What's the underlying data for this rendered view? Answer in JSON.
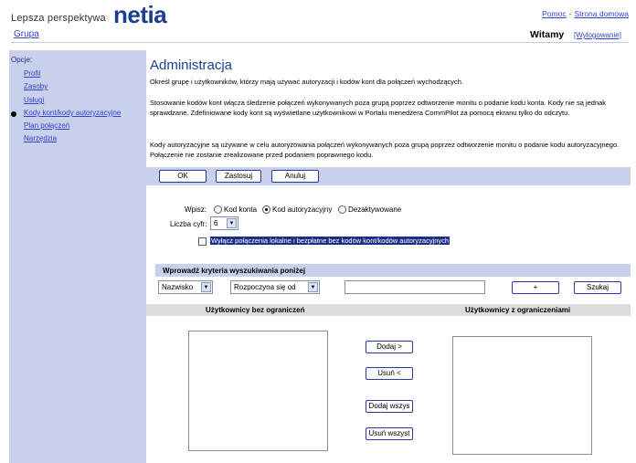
{
  "header": {
    "logo_tagline": "Lepsza perspektywa",
    "logo_word": "netia",
    "help_link": "Pomoc",
    "separator": "-",
    "home_link": "Strona domowa",
    "group_link": "Grupa",
    "welcome": "Witamy",
    "logout_link": "[Wylogowanie]"
  },
  "sidebar": {
    "title": "Opcje:",
    "items": [
      {
        "label": "Profil"
      },
      {
        "label": "Zasoby"
      },
      {
        "label": "Usługi"
      },
      {
        "label": "Kody kont/kody autoryzacyjne",
        "active": true
      },
      {
        "label": "Plan połączeń"
      },
      {
        "label": "Narzędzia"
      }
    ]
  },
  "main": {
    "title": "Administracja",
    "desc1": "Określ grupę i użytkowników, którzy mają używać autoryzacji i kodów kont dla połączeń wychodzących.",
    "desc2": "Stosowanie kodów kont włącza śledzenie połączeń wykonywanych poza grupą poprzez odtworzenie monitu o podanie kodu konta. Kody nie są jednak sprawdzane. Zdefiniowane kody kont są wyświetlane użytkownikowi w Portalu menedżera CommPilot za pomocą ekranu tylko do odczytu.",
    "desc3": "Kody autoryzacyjne są używane w celu autoryzowania połączeń wykonywanych poza grupą poprzez odtworzenie monitu o podanie kodu autoryzacyjnego. Połączenie nie zostanie zrealizowane przed podaniem poprawnego kodu.",
    "buttons": {
      "ok": "OK",
      "apply": "Zastosuj",
      "cancel": "Anuluj"
    },
    "type_label": "Wpisz:",
    "type_options": [
      {
        "label": "Kod konta",
        "selected": false
      },
      {
        "label": "Kod autoryzacyjny",
        "selected": true
      },
      {
        "label": "Dezaktywowane",
        "selected": false
      }
    ],
    "digits_label": "Liczba cyfr:",
    "digits_value": "6",
    "checkbox_label": "Wyłącz połączenia lokalne i bezpłatne bez kodów kont/kodów autoryzacyjnych",
    "checkbox_checked": false,
    "search": {
      "title": "Wprowadź kryteria wyszukiwania poniżej",
      "field": "Nazwisko",
      "mode": "Rozpoczyna się od",
      "value": "",
      "add_label": "+",
      "search_label": "Szukaj"
    },
    "lists": {
      "unrestricted_title": "Użytkownicy bez ograniczeń",
      "restricted_title": "Użytkownicy z ograniczeniami",
      "add": "Dodaj >",
      "remove": "Usuń <",
      "add_all": "Dodaj wszys",
      "remove_all": "Usuń wszyst"
    }
  },
  "colors": {
    "brand": "#1b3e94",
    "accent": "#c8102e",
    "panel": "#c9d0ec",
    "link": "#3344cc"
  }
}
